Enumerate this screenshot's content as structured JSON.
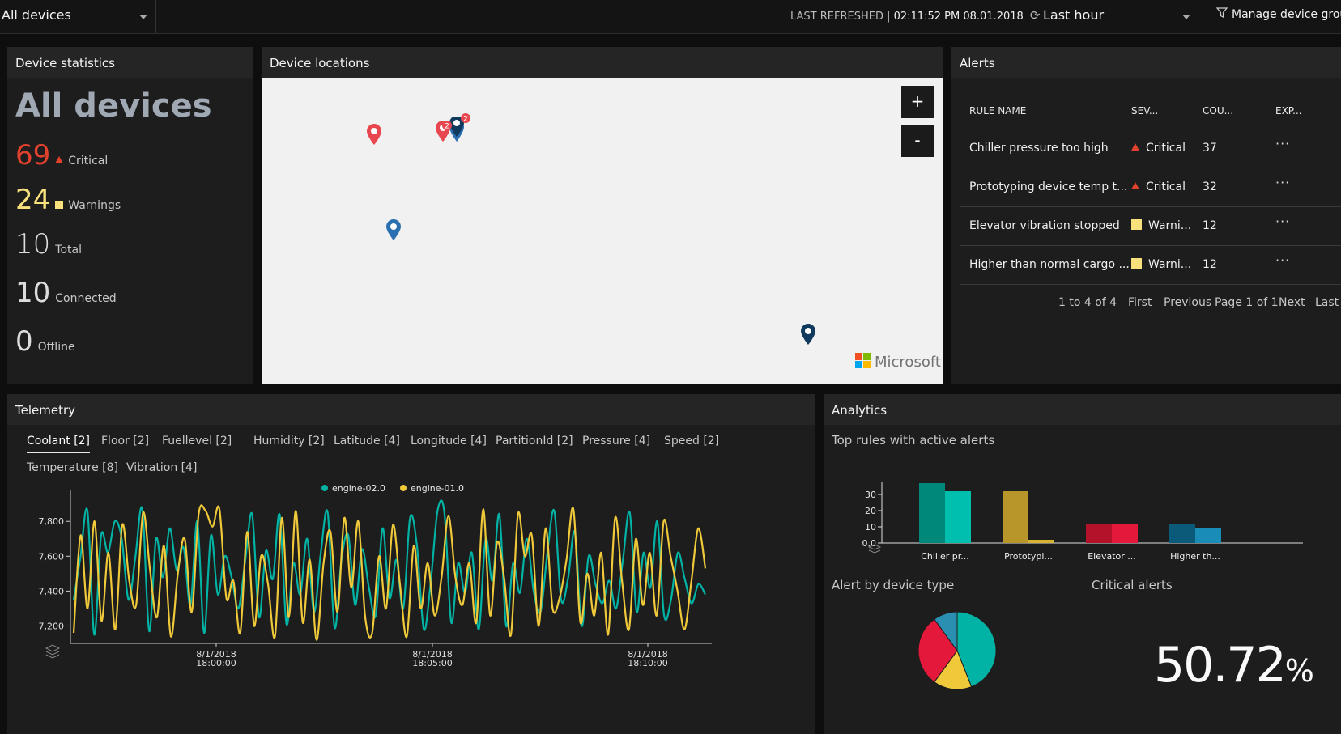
{
  "topbar": {
    "device_group": "All devices",
    "last_refreshed_label": "LAST REFRESHED |",
    "last_refreshed_value": "02:11:52 PM 08.01.2018",
    "time_range": "Last hour",
    "manage_label": "Manage device group"
  },
  "stats": {
    "title": "Device statistics",
    "heading": "All devices",
    "critical": {
      "value": "69",
      "label": "Critical"
    },
    "warnings": {
      "value": "24",
      "label": "Warnings"
    },
    "total": {
      "value": "10",
      "label": "Total"
    },
    "connected": {
      "value": "10",
      "label": "Connected"
    },
    "offline": {
      "value": "0",
      "label": "Offline"
    }
  },
  "map": {
    "title": "Device locations",
    "zoom_in": "+",
    "zoom_out": "-",
    "attribution": "Microsoft",
    "cluster_count_a": "2",
    "cluster_count_b": "2"
  },
  "alerts": {
    "title": "Alerts",
    "columns": [
      "RULE NAME",
      "SEV...",
      "COU...",
      "EXP..."
    ],
    "rows": [
      {
        "rule": "Chiller pressure too high",
        "severity": "Critical",
        "count": "37",
        "more": "···"
      },
      {
        "rule": "Prototyping device temp t...",
        "severity": "Critical",
        "count": "32",
        "more": "···"
      },
      {
        "rule": "Elevator vibration stopped",
        "severity": "Warni...",
        "count": "12",
        "more": "···"
      },
      {
        "rule": "Higher than normal cargo ...",
        "severity": "Warni...",
        "count": "12",
        "more": "···"
      }
    ],
    "pager": {
      "range": "1 to 4 of 4",
      "first": "First",
      "previous": "Previous",
      "page": "Page 1 of 1",
      "next": "Next",
      "last": "Last"
    }
  },
  "telemetry": {
    "title": "Telemetry",
    "tabs": [
      "Coolant [2]",
      "Floor [2]",
      "Fuellevel [2]",
      "Humidity [2]",
      "Latitude [4]",
      "Longitude [4]",
      "PartitionId [2]",
      "Pressure [4]",
      "Speed [2]",
      "Temperature [8]",
      "Vibration [4]"
    ],
    "active_tab": "Coolant [2]"
  },
  "analytics": {
    "title": "Analytics",
    "top_rules_title": "Top rules with active alerts",
    "alert_by_type_title": "Alert by device type",
    "critical_title": "Critical alerts",
    "critical_value": "50.72",
    "critical_unit": "%"
  },
  "colors": {
    "critical": "#e2412d",
    "warning": "#f8e17c",
    "teal": "#00b3a4",
    "yellow": "#f0c93a",
    "navy": "#0f3a5e",
    "pin_red": "#e8474f"
  },
  "chart_data": [
    {
      "type": "line",
      "title": "",
      "xlabel": "",
      "ylabel": "",
      "legend_position": "top-center",
      "x_ticks": [
        "8/1/2018 18:00:00",
        "8/1/2018 18:05:00",
        "8/1/2018 18:10:00"
      ],
      "y_ticks": [
        "7,200",
        "7,400",
        "7,600",
        "7,800"
      ],
      "ylim": [
        7100,
        7880
      ],
      "series": [
        {
          "name": "engine-02.0",
          "color": "#00b3a4",
          "values": [
            7350,
            7600,
            7860,
            7150,
            7720,
            7620,
            7800,
            7700,
            7350,
            7600,
            7870,
            7170,
            7700,
            7480,
            7760,
            7520,
            7650,
            7320,
            7800,
            7160,
            7720,
            7380,
            7600,
            7480,
            7300,
            7580,
            7840,
            7250,
            7630,
            7470,
            7840,
            7210,
            7560,
            7380,
            7700,
            7280,
            7620,
            7850,
            7190,
            7580,
            7720,
            7320,
            7640,
            7420,
            7260,
            7760,
            7360,
            7580,
            7300,
            7820,
            7660,
            7180,
            7450,
            7860,
            7850,
            7220,
            7560,
            7390,
            7620,
            7180,
            7700,
            7460,
            7840,
            7200,
            7560,
            7390,
            7700,
            7400,
            7280,
            7620,
            7860,
            7350,
            7470,
            7740,
            7200,
            7600,
            7440,
            7330,
            7460,
            7300,
            7580,
            7850,
            7280,
            7620,
            7420,
            7800,
            7260,
            7350,
            7620,
            7470,
            7330,
            7440,
            7380
          ]
        },
        {
          "name": "engine-01.0",
          "color": "#f0c93a",
          "values": [
            7160,
            7720,
            7300,
            7800,
            7230,
            7620,
            7180,
            7780,
            7460,
            7320,
            7850,
            7520,
            7250,
            7660,
            7140,
            7500,
            7700,
            7280,
            7840,
            7860,
            7770,
            7870,
            7360,
            7460,
            7160,
            7740,
            7200,
            7600,
            7440,
            7140,
            7820,
            7250,
            7860,
            7220,
            7580,
            7120,
            7560,
            7740,
            7280,
            7820,
            7420,
            7800,
            7250,
            7160,
            7600,
            7300,
            7780,
            7440,
            7140,
            7660,
            7300,
            7560,
            7260,
            7480,
            7830,
            7480,
            7320,
            7560,
            7220,
            7870,
            7260,
            7680,
            7480,
            7150,
            7840,
            7600,
            7720,
            7200,
            7760,
            7300,
            7360,
            7580,
            7870,
            7220,
            7500,
            7260,
            7620,
            7150,
            7820,
            7460,
            7180,
            7700,
            7320,
            7620,
            7260,
            7800,
            7600,
            7400,
            7180,
            7460,
            7760,
            7530
          ]
        }
      ]
    },
    {
      "type": "bar",
      "title": "Top rules with active alerts",
      "categories": [
        "Chiller pr...",
        "Prototypi...",
        "Elevator ...",
        "Higher th..."
      ],
      "y_ticks": [
        "0.0",
        "10",
        "20",
        "30"
      ],
      "ylim": [
        0,
        36
      ],
      "series": [
        {
          "values": [
            37,
            32,
            12,
            12
          ]
        },
        {
          "values": [
            32,
            2,
            12,
            9
          ]
        }
      ],
      "bar_colors": [
        [
          "#00897b",
          "#00bfae"
        ],
        [
          "#b8962a",
          "#d8b432"
        ],
        [
          "#b4122a",
          "#e4183a"
        ],
        [
          "#0c5a7a",
          "#1a8cb8"
        ]
      ]
    },
    {
      "type": "pie",
      "title": "Alert by device type",
      "slices": [
        {
          "value": 0.44,
          "color": "#00b3a4"
        },
        {
          "value": 0.16,
          "color": "#f0c93a"
        },
        {
          "value": 0.3,
          "color": "#e4183a"
        },
        {
          "value": 0.1,
          "color": "#2a8fb0"
        }
      ]
    }
  ]
}
